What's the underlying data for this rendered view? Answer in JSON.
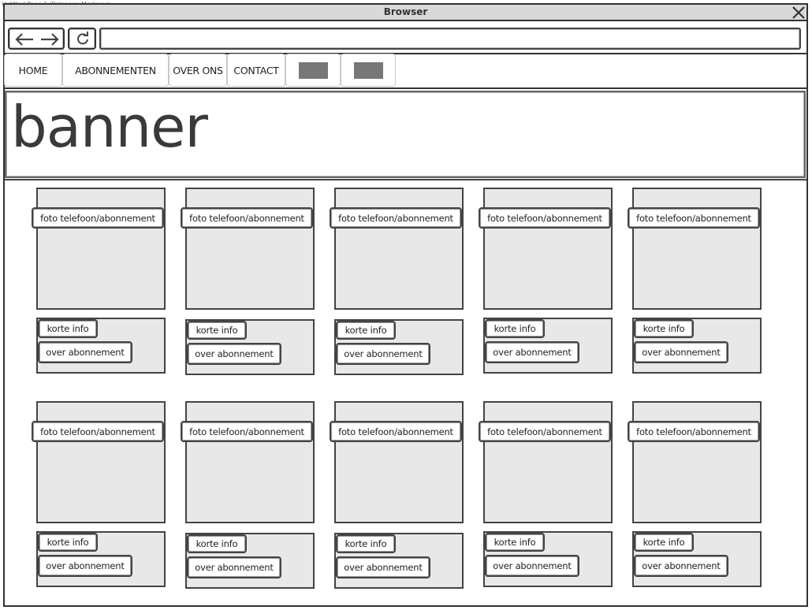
{
  "caption": "Untitled Page 1 (Balsamiq Mockups)",
  "window": {
    "title": "Browser"
  },
  "tabs": [
    {
      "label": "HOME"
    },
    {
      "label": "ABONNEMENTEN"
    },
    {
      "label": "OVER ONS"
    },
    {
      "label": "CONTACT"
    }
  ],
  "banner": {
    "text": "banner"
  },
  "cards": {
    "photo_label": "foto telefoon/abonnement",
    "korte_info_label": "korte info",
    "over_label": "over abonnement"
  }
}
